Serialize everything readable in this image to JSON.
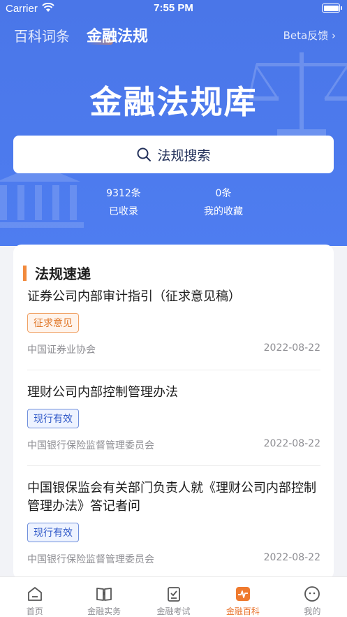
{
  "status": {
    "carrier": "Carrier",
    "time": "7:55 PM"
  },
  "nav": {
    "tab_encyclopedia": "百科词条",
    "tab_regulations": "金融法规",
    "feedback": "Beta反馈 ›"
  },
  "hero": {
    "title": "金融法规库",
    "search_label": "法规搜索"
  },
  "stats": [
    {
      "value": "9312条",
      "label": "已收录"
    },
    {
      "value": "0条",
      "label": "我的收藏"
    }
  ],
  "section": {
    "title": "法规速递"
  },
  "articles": [
    {
      "title": "证券公司内部审计指引（征求意见稿）",
      "tag": "征求意见",
      "tag_color": "#e0782a",
      "source": "中国证券业协会",
      "date": "2022-08-22"
    },
    {
      "title": "理财公司内部控制管理办法",
      "tag": "现行有效",
      "tag_color": "#2f58c8",
      "source": "中国银行保险监督管理委员会",
      "date": "2022-08-22"
    },
    {
      "title": "中国银保监会有关部门负责人就《理财公司内部控制管理办法》答记者问",
      "tag": "现行有效",
      "tag_color": "#2f58c8",
      "source": "中国银行保险监督管理委员会",
      "date": "2022-08-22"
    }
  ],
  "tabbar": [
    {
      "label": "首页",
      "icon": "home-icon"
    },
    {
      "label": "金融实务",
      "icon": "book-icon"
    },
    {
      "label": "金融考试",
      "icon": "exam-icon"
    },
    {
      "label": "金融百科",
      "icon": "wiki-icon",
      "active": true
    },
    {
      "label": "我的",
      "icon": "profile-icon"
    }
  ],
  "colors": {
    "primary": "#4e7df0",
    "accent": "#e8732c"
  }
}
